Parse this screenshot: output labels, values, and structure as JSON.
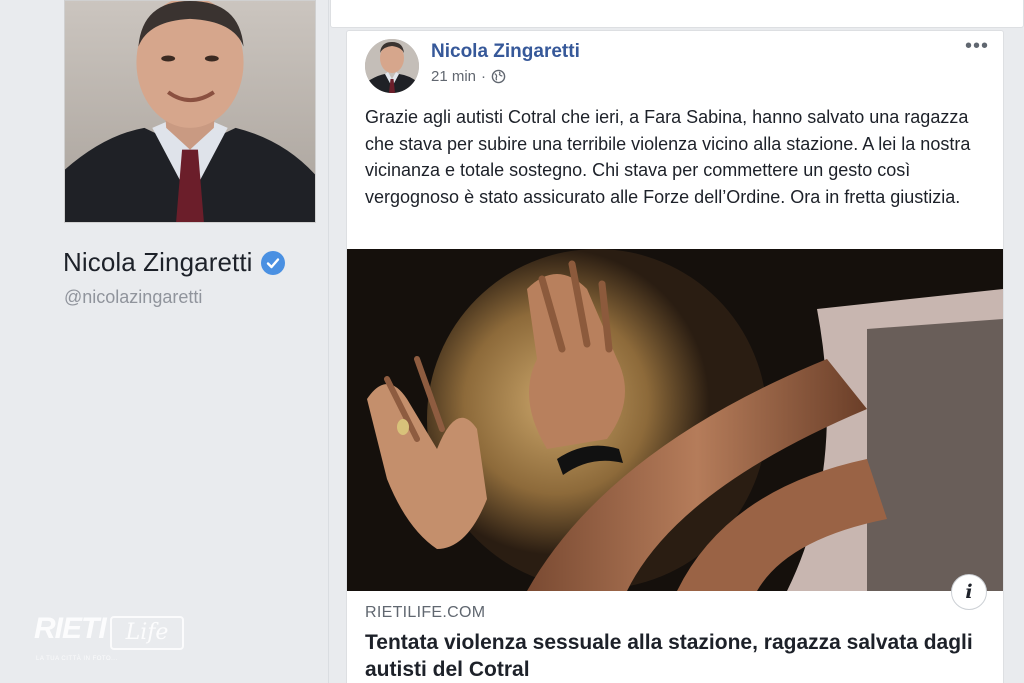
{
  "profile": {
    "name": "Nicola Zingaretti",
    "handle": "@nicolazingaretti",
    "verified": true
  },
  "watermark": {
    "brand": "RIETI",
    "logo": "Life",
    "tagline": "LA TUA CITTÀ IN FOTO..."
  },
  "post": {
    "author": "Nicola Zingaretti",
    "time": "21 min",
    "separator": "·",
    "audience_icon": "globe-icon",
    "more_icon": "•••",
    "text": "Grazie agli autisti Cotral che ieri, a Fara Sabina, hanno salvato una ragazza che stava per subire una terribile violenza vicino alla stazione. A lei la nostra vicinanza e totale sostegno. Chi stava per commettere un gesto così vergognoso è stato assicurato alle Forze dell’Ordine. Ora in fretta giustizia.",
    "link": {
      "domain": "RIETILIFE.COM",
      "title": "Tentata violenza sessuale alla stazione, ragazza salvata dagli autisti del Cotral",
      "info_icon": "i"
    }
  },
  "colors": {
    "author_link": "#365899",
    "verified_badge": "#4a90e2",
    "page_bg": "#e9ebee"
  }
}
